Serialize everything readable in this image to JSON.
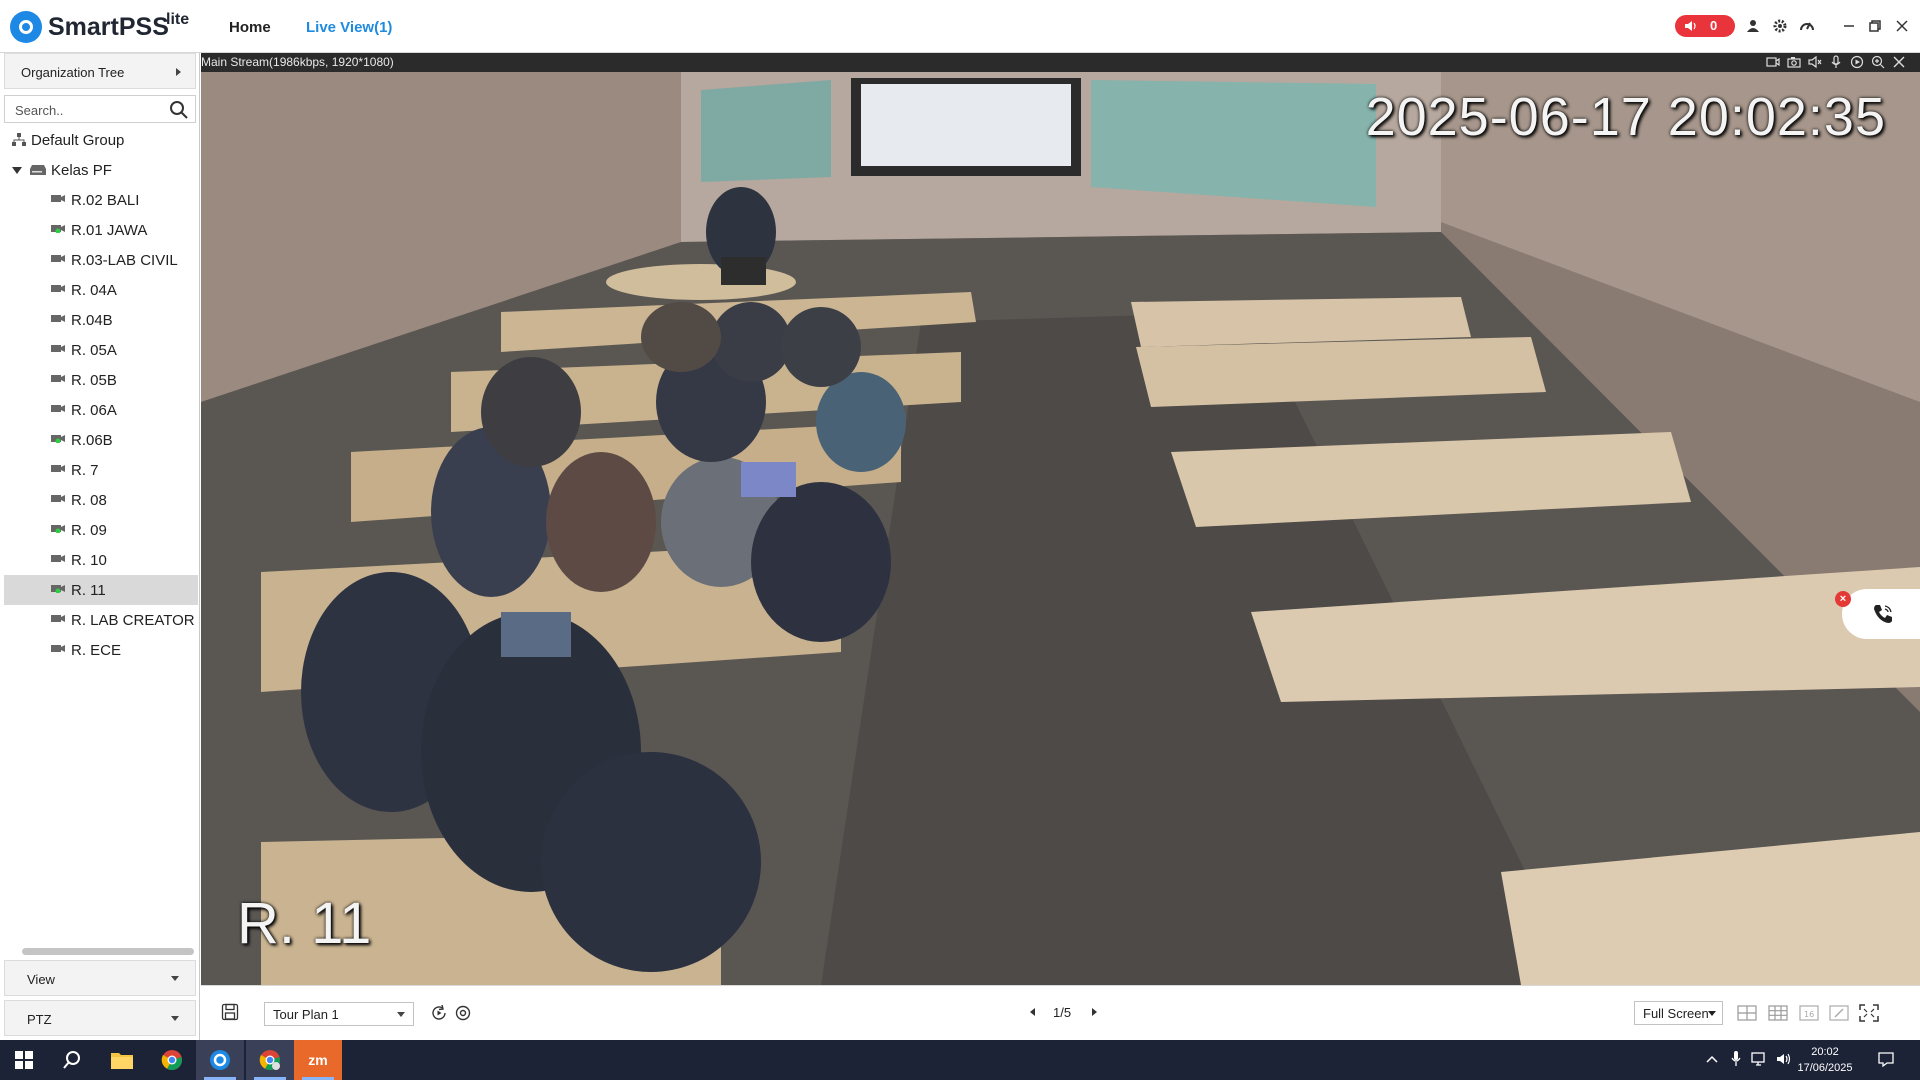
{
  "titlebar": {
    "app_name": "SmartPSS",
    "app_suffix": "lite",
    "tabs": [
      {
        "label": "Home"
      },
      {
        "label": "Live View(1)"
      }
    ],
    "alarm_count": "0"
  },
  "sidebar": {
    "section_title": "Organization Tree",
    "search_placeholder": "Search..",
    "tree": {
      "root": "Default Group",
      "group": "Kelas PF",
      "devices": [
        {
          "label": "R.02 BALI",
          "online": false
        },
        {
          "label": "R.01 JAWA",
          "online": true
        },
        {
          "label": "R.03-LAB CIVIL",
          "online": false
        },
        {
          "label": "R. 04A",
          "online": false
        },
        {
          "label": "R.04B",
          "online": false
        },
        {
          "label": "R. 05A",
          "online": false
        },
        {
          "label": "R. 05B",
          "online": false
        },
        {
          "label": "R. 06A",
          "online": false
        },
        {
          "label": "R.06B",
          "online": true
        },
        {
          "label": "R. 7",
          "online": false
        },
        {
          "label": "R. 08",
          "online": false
        },
        {
          "label": "R. 09",
          "online": true
        },
        {
          "label": "R. 10",
          "online": false
        },
        {
          "label": "R. 11",
          "online": true,
          "selected": true
        },
        {
          "label": "R. LAB CREATOR",
          "online": false
        },
        {
          "label": "R. ECE",
          "online": false
        }
      ]
    },
    "view_label": "View",
    "ptz_label": "PTZ"
  },
  "video": {
    "stream_info": "Main Stream(1986kbps, 1920*1080)",
    "osd_timestamp": "2025-06-17  20:02:35",
    "osd_channel": "R. 11"
  },
  "bottom_bar": {
    "tour_plan": "Tour Plan 1",
    "page_indicator": "1/5",
    "display_mode": "Full Screen"
  },
  "taskbar": {
    "time": "20:02",
    "date": "17/06/2025",
    "zoom_label": "zm"
  },
  "colors": {
    "accent": "#1e8be0",
    "alarm": "#e8343a",
    "online": "#2ecc40",
    "taskbar": "#1d2337"
  }
}
